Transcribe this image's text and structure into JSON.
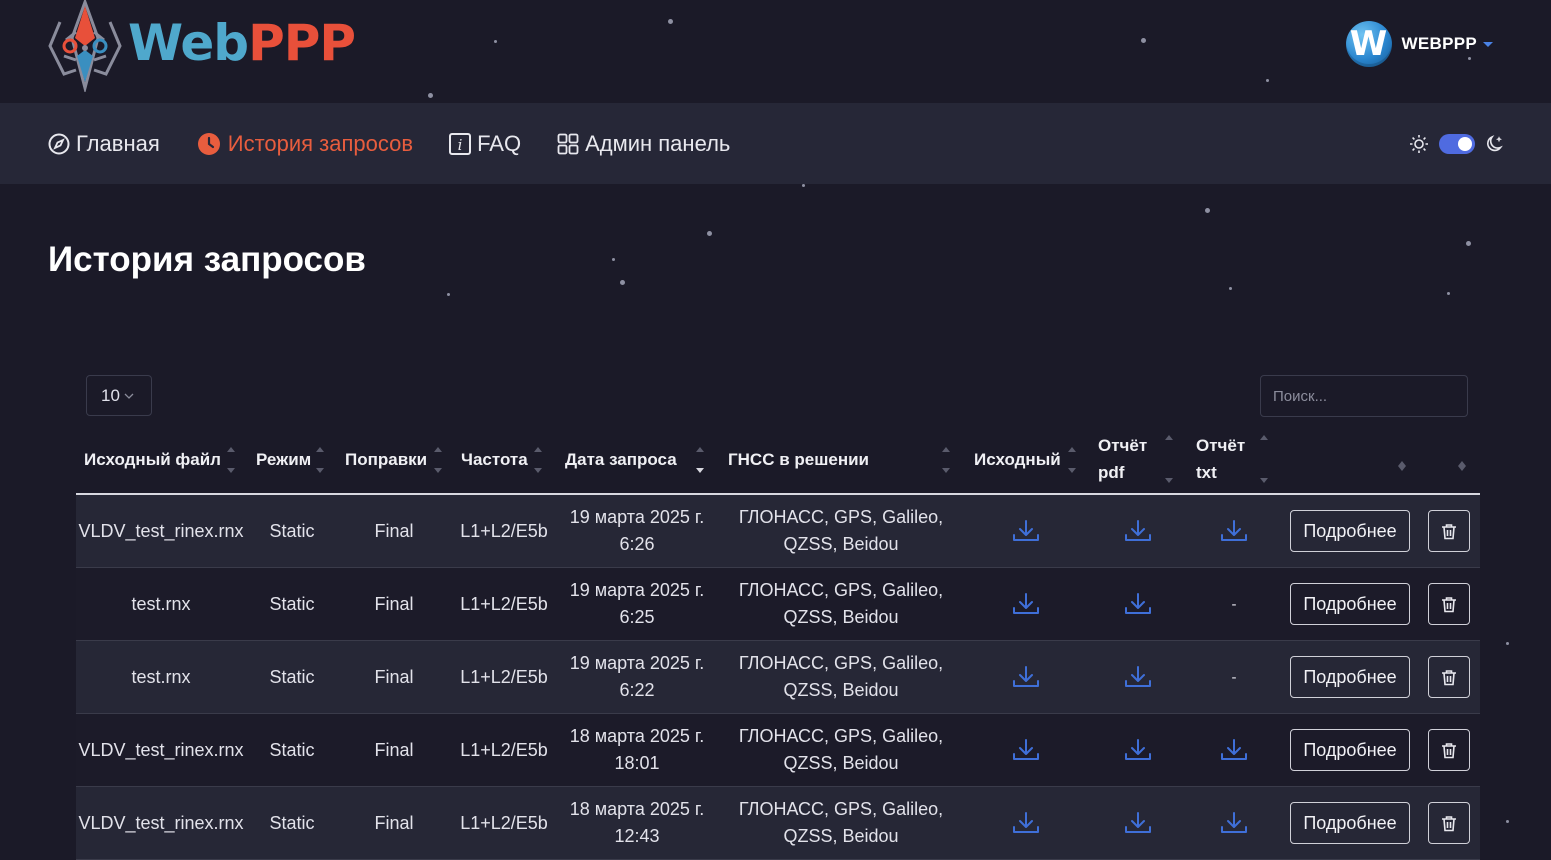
{
  "header": {
    "logo_part1": "Web",
    "logo_part2": "PPP",
    "user_initial": "W",
    "username": "WEBPPP"
  },
  "nav": {
    "items": [
      {
        "label": "Главная",
        "icon": "compass-icon",
        "active": false
      },
      {
        "label": "История запросов",
        "icon": "clock-icon",
        "active": true
      },
      {
        "label": "FAQ",
        "icon": "info-icon",
        "active": false
      },
      {
        "label": "Админ панель",
        "icon": "grid-icon",
        "active": false
      }
    ],
    "theme_mode": "dark"
  },
  "page": {
    "title": "История запросов"
  },
  "controls": {
    "page_size": "10",
    "search_placeholder": "Поиск..."
  },
  "table": {
    "columns": [
      "Исходный файл",
      "Режим",
      "Поправки",
      "Частота",
      "Дата запроса",
      "ГНСС в решении",
      "Исходный",
      "Отчёт pdf",
      "Отчёт txt"
    ],
    "details_label": "Подробнее",
    "rows": [
      {
        "file": "VLDV_test_rinex.rnx",
        "mode": "Static",
        "corrections": "Final",
        "frequency": "L1+L2/E5b",
        "date": "19 марта 2025 г.",
        "time": "6:26",
        "gnss1": "ГЛОНАСС, GPS, Galileo,",
        "gnss2": "QZSS, Beidou",
        "src": true,
        "pdf": true,
        "txt": true
      },
      {
        "file": "test.rnx",
        "mode": "Static",
        "corrections": "Final",
        "frequency": "L1+L2/E5b",
        "date": "19 марта 2025 г.",
        "time": "6:25",
        "gnss1": "ГЛОНАСС, GPS, Galileo,",
        "gnss2": "QZSS, Beidou",
        "src": true,
        "pdf": true,
        "txt": false
      },
      {
        "file": "test.rnx",
        "mode": "Static",
        "corrections": "Final",
        "frequency": "L1+L2/E5b",
        "date": "19 марта 2025 г.",
        "time": "6:22",
        "gnss1": "ГЛОНАСС, GPS, Galileo,",
        "gnss2": "QZSS, Beidou",
        "src": true,
        "pdf": true,
        "txt": false
      },
      {
        "file": "VLDV_test_rinex.rnx",
        "mode": "Static",
        "corrections": "Final",
        "frequency": "L1+L2/E5b",
        "date": "18 марта 2025 г.",
        "time": "18:01",
        "gnss1": "ГЛОНАСС, GPS, Galileo,",
        "gnss2": "QZSS, Beidou",
        "src": true,
        "pdf": true,
        "txt": true
      },
      {
        "file": "VLDV_test_rinex.rnx",
        "mode": "Static",
        "corrections": "Final",
        "frequency": "L1+L2/E5b",
        "date": "18 марта 2025 г.",
        "time": "12:43",
        "gnss1": "ГЛОНАСС, GPS, Galileo,",
        "gnss2": "QZSS, Beidou",
        "src": true,
        "pdf": true,
        "txt": true
      }
    ],
    "empty_mark": "-"
  },
  "colors": {
    "background": "#1b1a28",
    "navbar": "#262737",
    "accent": "#e85d3e",
    "download_icon": "#3f6fd8",
    "toggle": "#4f6be0"
  }
}
